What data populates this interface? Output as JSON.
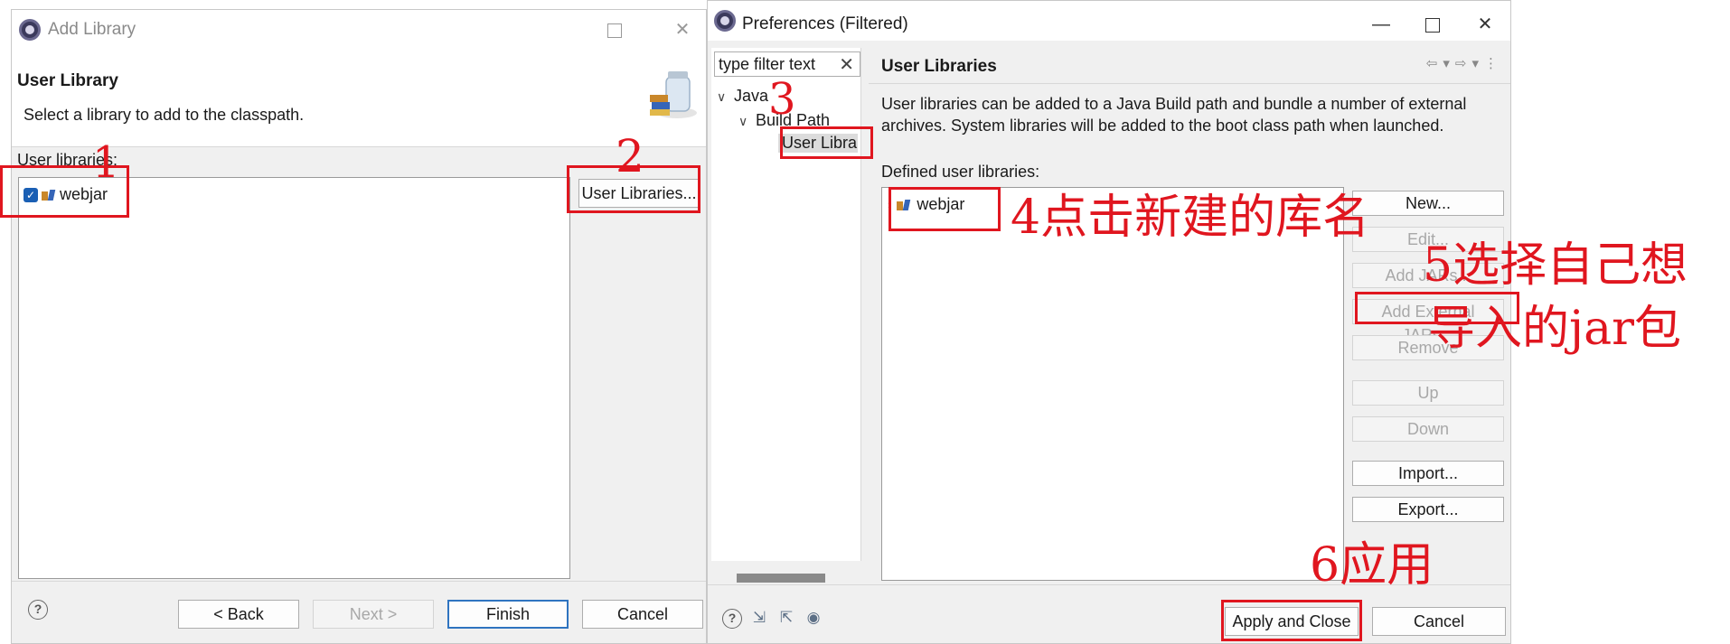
{
  "add_library": {
    "window_title": "Add Library",
    "header_title": "User Library",
    "header_subtitle": "Select a library to add to the classpath.",
    "list_label": "User libraries:",
    "items": [
      {
        "label": "webjar",
        "checked": true
      }
    ],
    "user_libraries_button": "User Libraries...",
    "footer": {
      "back": "< Back",
      "next": "Next >",
      "finish": "Finish",
      "cancel": "Cancel"
    }
  },
  "preferences": {
    "window_title": "Preferences (Filtered)",
    "filter_text": "type filter text",
    "tree": [
      {
        "label": "Java"
      },
      {
        "label": "Build Path"
      },
      {
        "label": "User Librar",
        "selected": true
      }
    ],
    "page_title": "User Libraries",
    "description": "User libraries can be added to a Java Build path and bundle a number of external archives. System libraries will be added to the boot class path when launched.",
    "list_label": "Defined user libraries:",
    "items": [
      {
        "label": "webjar"
      }
    ],
    "buttons": {
      "new": "New...",
      "edit": "Edit...",
      "add_jars": "Add JARs...",
      "add_external_jars": "Add External JARs...",
      "remove": "Remove",
      "up": "Up",
      "down": "Down",
      "import": "Import...",
      "export": "Export..."
    },
    "footer": {
      "apply_close": "Apply and Close",
      "cancel": "Cancel"
    }
  },
  "annotations": {
    "a1": "1",
    "a2": "2",
    "a3": "3",
    "a4": "4点击新建的库名",
    "a5_line1": "5选择自己想",
    "a5_line2": "导入的jar包",
    "a6": "6应用"
  },
  "colors": {
    "annotation_red": "#e0161f",
    "selection_blue": "#1a5fb4"
  }
}
